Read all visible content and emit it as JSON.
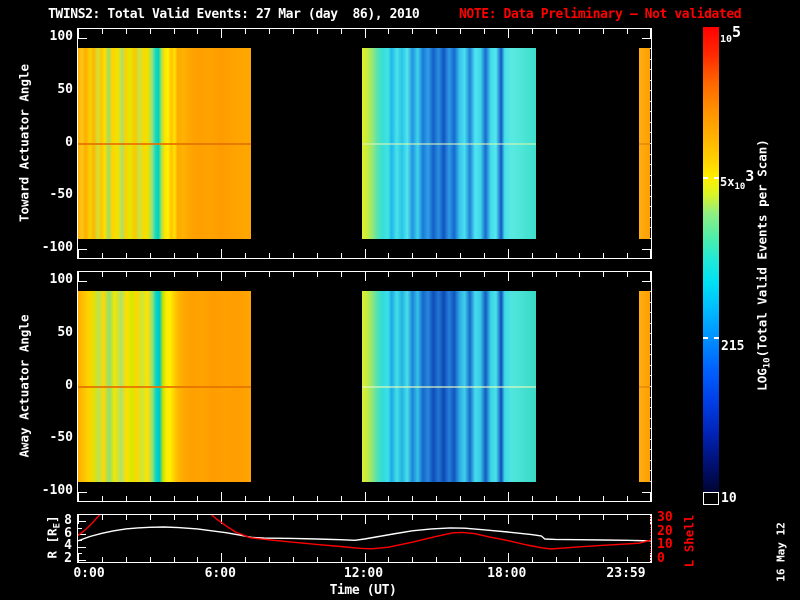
{
  "title": {
    "main": "TWINS2: Total Valid Events: 27 Mar (day  86), 2010",
    "note": "NOTE: Data Preliminary – Not validated"
  },
  "colors": {
    "background": "#000000",
    "foreground": "#ffffff",
    "note": "#ff0000",
    "l_shell": "#ff0000",
    "r_curve": "#ffffff"
  },
  "footer_date": "16 May 12",
  "time_axis": {
    "label": "Time (UT)",
    "range_hours": [
      0,
      24
    ],
    "major_tick_hours": [
      0,
      6,
      12,
      18,
      24
    ],
    "major_tick_labels": [
      "0:00",
      "6:00",
      "12:00",
      "18:00",
      "23:59"
    ],
    "minor_tick_step_hours": 1
  },
  "heatmap_y_axis": {
    "tick_values": [
      100,
      50,
      0,
      -50,
      -100
    ],
    "tick_labels": [
      "100",
      "50",
      "0",
      "-50",
      "-100"
    ],
    "minor_step": 10,
    "range": [
      -109,
      109
    ]
  },
  "panels": [
    {
      "key": "toward",
      "ylabel": "Toward Actuator Angle"
    },
    {
      "key": "away",
      "ylabel": "Away Actuator Angle"
    }
  ],
  "ephemeris": {
    "left_label_parts": {
      "prefix": "R [R",
      "sub": "E",
      "suffix": "]"
    },
    "left_ticks": [
      2,
      4,
      6,
      8
    ],
    "left_range": [
      1.69,
      9.08
    ],
    "right_label": "L Shell",
    "right_ticks": [
      0,
      10,
      20,
      30
    ],
    "right_minor_step": 2,
    "right_range": [
      -1.43,
      32.9
    ]
  },
  "colorbar": {
    "label_parts": {
      "prefix": "LOG",
      "sub": "10",
      "suffix": "(Total Valid Events per Scan)"
    },
    "range_log10": [
      1,
      5
    ],
    "top_label": {
      "base": "10",
      "exp": "5"
    },
    "mid_label": {
      "base": "5x",
      "sub": "10",
      "exp": "3"
    },
    "mid_frac": 0.325,
    "low_label": "215",
    "low_frac": 0.667,
    "bottom_label": "10",
    "stops": [
      [
        0,
        "#ff0000"
      ],
      [
        0.06,
        "#ff2a00"
      ],
      [
        0.12,
        "#ff6600"
      ],
      [
        0.18,
        "#ff9100"
      ],
      [
        0.24,
        "#ffb400"
      ],
      [
        0.29,
        "#ffd400"
      ],
      [
        0.325,
        "#fff000"
      ],
      [
        0.36,
        "#d8f428"
      ],
      [
        0.4,
        "#90ee80"
      ],
      [
        0.45,
        "#50eea8"
      ],
      [
        0.5,
        "#20ead8"
      ],
      [
        0.55,
        "#00e0f4"
      ],
      [
        0.61,
        "#00b8ff"
      ],
      [
        0.667,
        "#0090ff"
      ],
      [
        0.73,
        "#0064ff"
      ],
      [
        0.8,
        "#0040e8"
      ],
      [
        0.87,
        "#0024b8"
      ],
      [
        0.94,
        "#001070"
      ],
      [
        1,
        "#000430"
      ]
    ]
  },
  "chart_data": [
    {
      "type": "heatmap",
      "title": "Toward Actuator Angle spectrogram",
      "xlabel": "Time (UT)",
      "ylabel": "Toward Actuator Angle",
      "xlim_hours": [
        0,
        24
      ],
      "ylim": [
        -109,
        109
      ],
      "data_extent_deg": [
        -90,
        90
      ],
      "value_scale": "log10 total valid events per scan, 10 to 1e5",
      "segments": [
        {
          "t_start": 0.0,
          "t_end": 7.25,
          "character": "high counts ~1e4 (orange/yellow) with green-cyan dropout stripe near 03:20",
          "zero_color": "rgba(230,118,0,0.9)",
          "stops": [
            [
              0,
              "#ffab00"
            ],
            [
              0.02,
              "#ffc618"
            ],
            [
              0.045,
              "#ffae00"
            ],
            [
              0.07,
              "#f5d400"
            ],
            [
              0.09,
              "#ffb400"
            ],
            [
              0.115,
              "#cfe23a"
            ],
            [
              0.135,
              "#ffc400"
            ],
            [
              0.155,
              "#ffdf00"
            ],
            [
              0.175,
              "#9fdd66"
            ],
            [
              0.2,
              "#ffd400"
            ],
            [
              0.23,
              "#f2e300"
            ],
            [
              0.255,
              "#a8e070"
            ],
            [
              0.275,
              "#ffd000"
            ],
            [
              0.3,
              "#dfe800"
            ],
            [
              0.33,
              "#ffc600"
            ],
            [
              0.355,
              "#bfe74a"
            ],
            [
              0.38,
              "#ffd800"
            ],
            [
              0.405,
              "#e8e400"
            ],
            [
              0.43,
              "#8fe08a"
            ],
            [
              0.448,
              "#17dbb8"
            ],
            [
              0.465,
              "#00cfc4"
            ],
            [
              0.482,
              "#a0e455"
            ],
            [
              0.5,
              "#ffe000"
            ],
            [
              0.52,
              "#fff200"
            ],
            [
              0.54,
              "#ffc000"
            ],
            [
              0.558,
              "#ffe600"
            ],
            [
              0.575,
              "#ffaa00"
            ],
            [
              0.61,
              "#ffb200"
            ],
            [
              0.65,
              "#ffa400"
            ],
            [
              0.7,
              "#ff9f00"
            ],
            [
              0.76,
              "#ffa300"
            ],
            [
              0.83,
              "#ff9c00"
            ],
            [
              0.9,
              "#ffa300"
            ],
            [
              1,
              "#ffa700"
            ]
          ]
        },
        {
          "t_start": 11.9,
          "t_end": 19.2,
          "character": "low counts ~100-1000 (cyan/blue), yellow-green edge at start, dark blue streaks mid",
          "zero_color": "rgba(216,246,180,0.55)",
          "stops": [
            [
              0,
              "#e4ef28"
            ],
            [
              0.03,
              "#c6ec3e"
            ],
            [
              0.06,
              "#93e878"
            ],
            [
              0.09,
              "#55e3b2"
            ],
            [
              0.12,
              "#35dfd8"
            ],
            [
              0.15,
              "#41e2e6"
            ],
            [
              0.17,
              "#1fb6ea"
            ],
            [
              0.2,
              "#4ae2ea"
            ],
            [
              0.23,
              "#28c4e4"
            ],
            [
              0.26,
              "#52e6ec"
            ],
            [
              0.29,
              "#2193e2"
            ],
            [
              0.32,
              "#3fd4ea"
            ],
            [
              0.35,
              "#1a7ad8"
            ],
            [
              0.38,
              "#2f9fe6"
            ],
            [
              0.41,
              "#135fc8"
            ],
            [
              0.44,
              "#2b8fe0"
            ],
            [
              0.47,
              "#0f54c0"
            ],
            [
              0.5,
              "#2f9be4"
            ],
            [
              0.53,
              "#1667d0"
            ],
            [
              0.56,
              "#38c2ea"
            ],
            [
              0.59,
              "#48e0ee"
            ],
            [
              0.62,
              "#2080d8"
            ],
            [
              0.65,
              "#4ee6f0"
            ],
            [
              0.68,
              "#40d8ea"
            ],
            [
              0.71,
              "#1a68d0"
            ],
            [
              0.74,
              "#44dcea"
            ],
            [
              0.77,
              "#52e8ee"
            ],
            [
              0.8,
              "#1356c4"
            ],
            [
              0.82,
              "#46e0ea"
            ],
            [
              0.86,
              "#5ae9e2"
            ],
            [
              0.9,
              "#52e7da"
            ],
            [
              0.95,
              "#47e2d2"
            ],
            [
              1,
              "#3eded0"
            ]
          ]
        },
        {
          "t_start": 23.5,
          "t_end": 23.95,
          "character": "narrow orange strip at end of day",
          "zero_color": "rgba(220,120,0,0.5)",
          "stops": [
            [
              0,
              "#ffae14"
            ],
            [
              1,
              "#ff9e00"
            ]
          ]
        }
      ]
    },
    {
      "type": "heatmap",
      "title": "Away Actuator Angle spectrogram",
      "xlabel": "Time (UT)",
      "ylabel": "Away Actuator Angle",
      "xlim_hours": [
        0,
        24
      ],
      "ylim": [
        -109,
        109
      ],
      "data_extent_deg": [
        -90,
        90
      ],
      "value_scale": "log10 total valid events per scan, 10 to 1e5",
      "segments": [
        {
          "t_start": 0.0,
          "t_end": 7.25,
          "character": "high counts, more yellow/green streaked than toward panel, cyan stripe near 03:20",
          "zero_color": "rgba(230,118,0,0.9)",
          "stops": [
            [
              0,
              "#ffaa00"
            ],
            [
              0.03,
              "#ffc000"
            ],
            [
              0.06,
              "#ffd200"
            ],
            [
              0.09,
              "#e8e000"
            ],
            [
              0.12,
              "#b8e455"
            ],
            [
              0.15,
              "#ffd800"
            ],
            [
              0.18,
              "#8adf7a"
            ],
            [
              0.21,
              "#f0e800"
            ],
            [
              0.25,
              "#aee26a"
            ],
            [
              0.28,
              "#ffe000"
            ],
            [
              0.31,
              "#d5ea00"
            ],
            [
              0.34,
              "#ffd600"
            ],
            [
              0.37,
              "#c9e83c"
            ],
            [
              0.4,
              "#ffe200"
            ],
            [
              0.43,
              "#99e175"
            ],
            [
              0.452,
              "#00d8c0"
            ],
            [
              0.472,
              "#00c4cf"
            ],
            [
              0.49,
              "#bfe500"
            ],
            [
              0.51,
              "#ffe800"
            ],
            [
              0.53,
              "#fff200"
            ],
            [
              0.555,
              "#ffd000"
            ],
            [
              0.58,
              "#ffb600"
            ],
            [
              0.62,
              "#ffa600"
            ],
            [
              0.67,
              "#ff9f00"
            ],
            [
              0.72,
              "#ffa400"
            ],
            [
              0.78,
              "#ff9c00"
            ],
            [
              0.85,
              "#ffa100"
            ],
            [
              0.92,
              "#ff9d00"
            ],
            [
              1,
              "#ffa500"
            ]
          ]
        },
        {
          "t_start": 11.9,
          "t_end": 19.2,
          "character": "low counts cyan/blue with broader dark-blue band 14:00-17:00",
          "zero_color": "rgba(225,250,190,0.6)",
          "stops": [
            [
              0,
              "#e0ee30"
            ],
            [
              0.03,
              "#c2ea44"
            ],
            [
              0.06,
              "#8ce67e"
            ],
            [
              0.09,
              "#4ee1b6"
            ],
            [
              0.12,
              "#30dcdc"
            ],
            [
              0.15,
              "#3cdfe8"
            ],
            [
              0.17,
              "#1ba8e6"
            ],
            [
              0.2,
              "#44dfe8"
            ],
            [
              0.23,
              "#22b2e0"
            ],
            [
              0.26,
              "#4adfe9"
            ],
            [
              0.29,
              "#1b82da"
            ],
            [
              0.32,
              "#36c2e6"
            ],
            [
              0.35,
              "#1566cc"
            ],
            [
              0.38,
              "#2887da"
            ],
            [
              0.41,
              "#0e4cba"
            ],
            [
              0.44,
              "#2377d2"
            ],
            [
              0.47,
              "#0c48b4"
            ],
            [
              0.5,
              "#2680d8"
            ],
            [
              0.53,
              "#1154c0"
            ],
            [
              0.56,
              "#2fa8e2"
            ],
            [
              0.59,
              "#3ed0ea"
            ],
            [
              0.62,
              "#1968cc"
            ],
            [
              0.65,
              "#44dcec"
            ],
            [
              0.68,
              "#38cce6"
            ],
            [
              0.71,
              "#1559c4"
            ],
            [
              0.74,
              "#3bd2e6"
            ],
            [
              0.77,
              "#48e2ea"
            ],
            [
              0.8,
              "#0f4cba"
            ],
            [
              0.82,
              "#3ed8e6"
            ],
            [
              0.86,
              "#50e5de"
            ],
            [
              0.9,
              "#4ae3d6"
            ],
            [
              0.95,
              "#40decd"
            ],
            [
              1,
              "#38dac8"
            ]
          ]
        },
        {
          "t_start": 23.5,
          "t_end": 23.95,
          "character": "narrow orange strip at end of day",
          "zero_color": "rgba(220,120,0,0.5)",
          "stops": [
            [
              0,
              "#ffae14"
            ],
            [
              1,
              "#ff9e00"
            ]
          ]
        }
      ]
    },
    {
      "type": "line",
      "title": "Spacecraft ephemeris",
      "xlabel": "Time (UT)",
      "x_range_hours": [
        0,
        24
      ],
      "series": [
        {
          "name": "R [RE]",
          "color": "#ffffff",
          "axis": "left",
          "points": [
            [
              0,
              5.0
            ],
            [
              0.5,
              5.7
            ],
            [
              1,
              6.2
            ],
            [
              1.5,
              6.6
            ],
            [
              2,
              6.9
            ],
            [
              2.5,
              7.05
            ],
            [
              3,
              7.15
            ],
            [
              3.6,
              7.2
            ],
            [
              4.2,
              7.1
            ],
            [
              5,
              6.9
            ],
            [
              5.6,
              6.6
            ],
            [
              6.2,
              6.3
            ],
            [
              6.8,
              5.9
            ],
            [
              7.3,
              5.55
            ],
            [
              7.8,
              5.45
            ],
            [
              9,
              5.4
            ],
            [
              10,
              5.3
            ],
            [
              11,
              5.2
            ],
            [
              11.6,
              5.1
            ],
            [
              12,
              5.3
            ],
            [
              12.6,
              5.7
            ],
            [
              13.2,
              6.1
            ],
            [
              14,
              6.6
            ],
            [
              14.8,
              6.9
            ],
            [
              15.6,
              7.05
            ],
            [
              16.2,
              7.0
            ],
            [
              17,
              6.75
            ],
            [
              18,
              6.4
            ],
            [
              19,
              6.0
            ],
            [
              19.4,
              5.8
            ],
            [
              19.55,
              5.3
            ],
            [
              20,
              5.25
            ],
            [
              21,
              5.2
            ],
            [
              22,
              5.15
            ],
            [
              23,
              5.1
            ],
            [
              24,
              5.0
            ]
          ]
        },
        {
          "name": "L Shell",
          "color": "#ff0000",
          "axis": "right",
          "points": [
            [
              0,
              18
            ],
            [
              0.3,
              22
            ],
            [
              0.6,
              27
            ],
            [
              0.9,
              33
            ],
            [
              1.5,
              48
            ],
            [
              3,
              70
            ],
            [
              4.5,
              52
            ],
            [
              5.4,
              36
            ],
            [
              5.8,
              30
            ],
            [
              6.2,
              25
            ],
            [
              6.6,
              20.5
            ],
            [
              7.2,
              16.3
            ],
            [
              8,
              14.8
            ],
            [
              9,
              13
            ],
            [
              10,
              11.4
            ],
            [
              11,
              9.9
            ],
            [
              11.8,
              8.6
            ],
            [
              12.3,
              8.2
            ],
            [
              13,
              9.4
            ],
            [
              14,
              13
            ],
            [
              15,
              17.3
            ],
            [
              15.7,
              19.9
            ],
            [
              16.1,
              20.2
            ],
            [
              16.6,
              19.3
            ],
            [
              17.2,
              17
            ],
            [
              18,
              14.2
            ],
            [
              18.8,
              11
            ],
            [
              19.4,
              9
            ],
            [
              19.8,
              8.1
            ],
            [
              20.2,
              8.6
            ],
            [
              21,
              9.7
            ],
            [
              22,
              10.8
            ],
            [
              23,
              11.8
            ],
            [
              23.5,
              12.3
            ],
            [
              24,
              14.6
            ]
          ]
        }
      ]
    }
  ]
}
